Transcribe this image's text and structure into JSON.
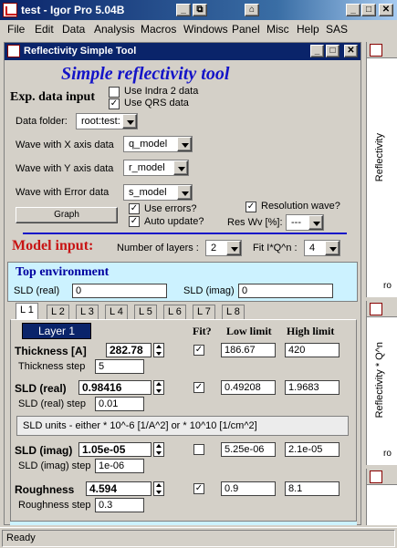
{
  "app": {
    "title": "test - Igor Pro 5.04B"
  },
  "menus": [
    "File",
    "Edit",
    "Data",
    "Analysis",
    "Macros",
    "Windows",
    "Panel",
    "Misc",
    "Help",
    "SAS"
  ],
  "panel": {
    "title": "Reflectivity Simple Tool",
    "heading": "Simple reflectivity tool",
    "exp_label": "Exp. data input",
    "use_indra": "Use Indra 2 data",
    "use_qrs": "Use QRS data",
    "use_indra_checked": "",
    "use_qrs_checked": "✓",
    "data_folder_label": "Data folder:",
    "data_folder_value": "root:test:",
    "x_label": "Wave with X axis data",
    "x_value": "q_model",
    "y_label": "Wave with Y axis data",
    "y_value": "r_model",
    "err_label": "Wave with Error data",
    "err_value": "s_model",
    "resolution_label": "Resolution wave?",
    "resolution_checked": "✓",
    "graph_button": "Graph",
    "use_errors_label": "Use errors?",
    "use_errors_checked": "✓",
    "auto_update_label": "Auto update?",
    "auto_update_checked": "✓",
    "res_wv_label": "Res Wv [%]:",
    "res_wv_value": "---",
    "model_label": "Model input:",
    "num_layers_label": "Number of layers :",
    "num_layers_value": "2",
    "fit_label": "Fit I*Q^n :",
    "fit_value": "4",
    "top_env_title": "Top environment",
    "sld_real_label": "SLD (real)",
    "sld_real_value": "0",
    "sld_imag_label": "SLD (imag)",
    "sld_imag_value": "0",
    "tabs": [
      "L 1",
      "L 2",
      "L 3",
      "L 4",
      "L 5",
      "L 6",
      "L 7",
      "L 8"
    ],
    "layer_title": "Layer 1",
    "fit_header": "Fit?",
    "low_header": "Low limit",
    "high_header": "High limit",
    "thickness_label": "Thickness [A]",
    "thickness_value": "282.78",
    "thickness_fit": "✓",
    "thickness_low": "186.67",
    "thickness_high": "420",
    "thickness_step_label": "Thickness step",
    "thickness_step_value": "5",
    "sldr_label": "SLD (real)",
    "sldr_value": "0.98416",
    "sldr_fit": "✓",
    "sldr_low": "0.49208",
    "sldr_high": "1.9683",
    "sldr_step_label": "SLD (real) step",
    "sldr_step_value": "0.01",
    "sld_units_note": "SLD units - either * 10^-6 [1/A^2] or * 10^10  [1/cm^2]",
    "sldi_label": "SLD (imag)",
    "sldi_value": "1.05e-05",
    "sldi_fit": "",
    "sldi_low": "5.25e-06",
    "sldi_high": "2.1e-05",
    "sldi_step_label": "SLD (imag) step",
    "sldi_step_value": "1e-06",
    "rough_label": "Roughness",
    "rough_value": "4.594",
    "rough_fit": "✓",
    "rough_low": "0.9",
    "rough_high": "8.1",
    "rough_step_label": "Roughness step",
    "rough_step_value": "0.3"
  },
  "side_graphs": [
    {
      "label": "Reflectivity",
      "corner": "ro"
    },
    {
      "label": "Reflectivity * Q^n",
      "corner": "ro"
    }
  ],
  "status": {
    "text": "Ready"
  },
  "colors": {
    "heading_blue": "#1414c8",
    "model_red": "#c81414",
    "env_box": "#ccf2ff",
    "env_title": "#0000a0"
  }
}
